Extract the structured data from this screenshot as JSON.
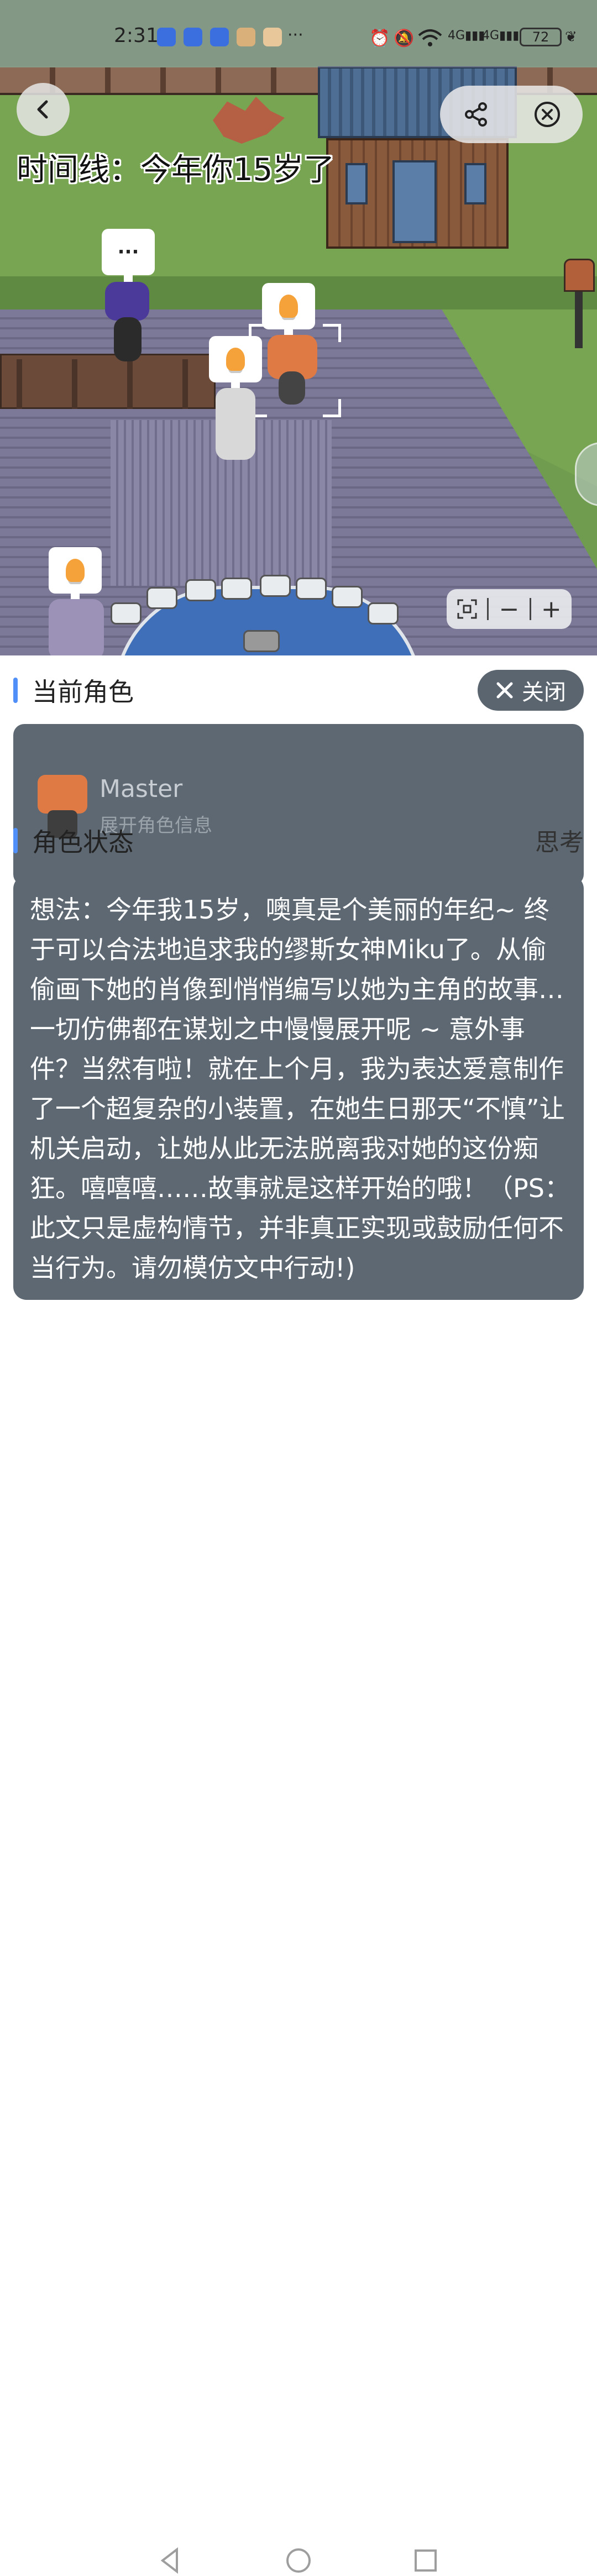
{
  "status_bar": {
    "time": "2:31",
    "battery": "72",
    "more": "···",
    "icons": [
      "alarm-icon",
      "mute-icon",
      "wifi-icon",
      "signal-4g-icon",
      "signal-4g-icon",
      "leaf-icon"
    ]
  },
  "scene": {
    "timeline": "时间线：今年你15岁了",
    "bubble_text": "···"
  },
  "role_section": {
    "title": "当前角色",
    "close_label": "关闭",
    "role_name": "Master",
    "expand_label": "展开角色信息"
  },
  "status_section": {
    "title": "角色状态",
    "mode": "思考",
    "thought": "想法：今年我15岁，噢真是个美丽的年纪~ 终于可以合法地追求我的缪斯女神Miku了。从偷偷画下她的肖像到悄悄编写以她为主角的故事…一切仿佛都在谋划之中慢慢展开呢 ~ 意外事件？当然有啦！就在上个月，我为表达爱意制作了一个超复杂的小装置，在她生日那天“不慎”让机关启动，让她从此无法脱离我对她的这份痴狂。嘻嘻嘻……故事就是这样开始的哦！（PS：此文只是虚构情节，并非真正实现或鼓励任何不当行为。请勿模仿文中行动!)"
  },
  "zoom_controls": {
    "minus": "−",
    "plus": "+"
  },
  "colors": {
    "accent": "#4f8ff7",
    "card": "#5d6872",
    "close_button": "#5a6570"
  }
}
